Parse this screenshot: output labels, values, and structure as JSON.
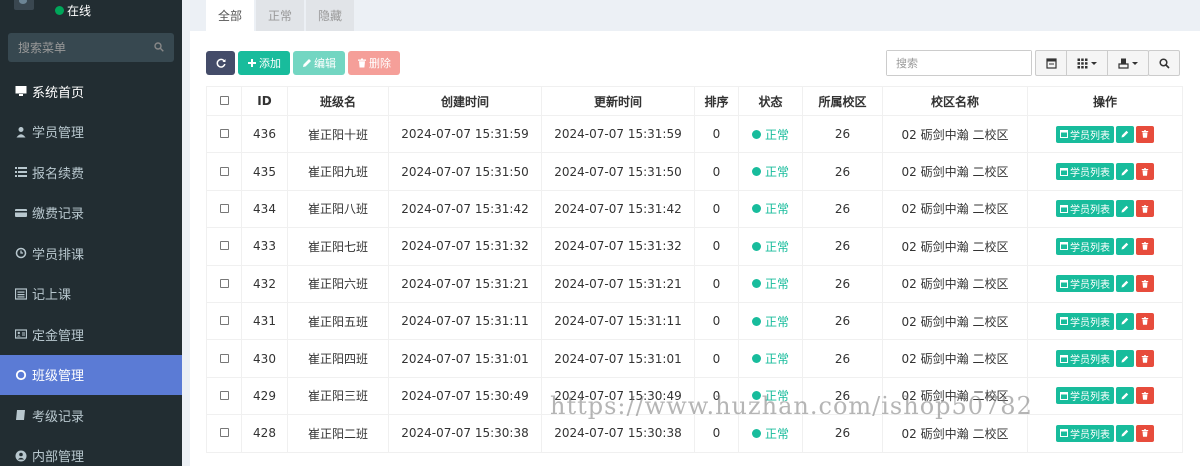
{
  "sidebar": {
    "status": "在线",
    "search_placeholder": "搜索菜单",
    "items": [
      {
        "label": "系统首页",
        "icon": "desktop-icon"
      },
      {
        "label": "学员管理",
        "icon": "user-icon"
      },
      {
        "label": "报名续费",
        "icon": "list-icon"
      },
      {
        "label": "缴费记录",
        "icon": "credit-card-icon"
      },
      {
        "label": "学员排课",
        "icon": "clock-icon"
      },
      {
        "label": "记上课",
        "icon": "list-alt-icon"
      },
      {
        "label": "定金管理",
        "icon": "id-card-icon"
      },
      {
        "label": "班级管理",
        "icon": "circle-icon"
      },
      {
        "label": "考级记录",
        "icon": "book-icon"
      },
      {
        "label": "内部管理",
        "icon": "user-circle-icon"
      }
    ],
    "active_index": 7
  },
  "tabs": [
    "全部",
    "正常",
    "隐藏"
  ],
  "toolbar": {
    "add_label": "添加",
    "edit_label": "编辑",
    "delete_label": "删除",
    "search_placeholder": "搜索"
  },
  "table": {
    "headers": [
      "ID",
      "班级名",
      "创建时间",
      "更新时间",
      "排序",
      "状态",
      "所属校区",
      "校区名称",
      "操作"
    ],
    "op_list_label": "学员列表",
    "rows": [
      {
        "id": "436",
        "name": "崔正阳十班",
        "created": "2024-07-07 15:31:59",
        "updated": "2024-07-07 15:31:59",
        "sort": "0",
        "status": "正常",
        "campus_id": "26",
        "campus_name": "02 砺剑中瀚 二校区"
      },
      {
        "id": "435",
        "name": "崔正阳九班",
        "created": "2024-07-07 15:31:50",
        "updated": "2024-07-07 15:31:50",
        "sort": "0",
        "status": "正常",
        "campus_id": "26",
        "campus_name": "02 砺剑中瀚 二校区"
      },
      {
        "id": "434",
        "name": "崔正阳八班",
        "created": "2024-07-07 15:31:42",
        "updated": "2024-07-07 15:31:42",
        "sort": "0",
        "status": "正常",
        "campus_id": "26",
        "campus_name": "02 砺剑中瀚 二校区"
      },
      {
        "id": "433",
        "name": "崔正阳七班",
        "created": "2024-07-07 15:31:32",
        "updated": "2024-07-07 15:31:32",
        "sort": "0",
        "status": "正常",
        "campus_id": "26",
        "campus_name": "02 砺剑中瀚 二校区"
      },
      {
        "id": "432",
        "name": "崔正阳六班",
        "created": "2024-07-07 15:31:21",
        "updated": "2024-07-07 15:31:21",
        "sort": "0",
        "status": "正常",
        "campus_id": "26",
        "campus_name": "02 砺剑中瀚 二校区"
      },
      {
        "id": "431",
        "name": "崔正阳五班",
        "created": "2024-07-07 15:31:11",
        "updated": "2024-07-07 15:31:11",
        "sort": "0",
        "status": "正常",
        "campus_id": "26",
        "campus_name": "02 砺剑中瀚 二校区"
      },
      {
        "id": "430",
        "name": "崔正阳四班",
        "created": "2024-07-07 15:31:01",
        "updated": "2024-07-07 15:31:01",
        "sort": "0",
        "status": "正常",
        "campus_id": "26",
        "campus_name": "02 砺剑中瀚 二校区"
      },
      {
        "id": "429",
        "name": "崔正阳三班",
        "created": "2024-07-07 15:30:49",
        "updated": "2024-07-07 15:30:49",
        "sort": "0",
        "status": "正常",
        "campus_id": "26",
        "campus_name": "02 砺剑中瀚 二校区"
      },
      {
        "id": "428",
        "name": "崔正阳二班",
        "created": "2024-07-07 15:30:38",
        "updated": "2024-07-07 15:30:38",
        "sort": "0",
        "status": "正常",
        "campus_id": "26",
        "campus_name": "02 砺剑中瀚 二校区"
      }
    ]
  },
  "watermark": "https://www.huzhan.com/ishop50782",
  "colors": {
    "sidebar_bg": "#222d32",
    "sidebar_active": "#5b7bd5",
    "success": "#18bc9c",
    "danger": "#e74c3c",
    "primary_dark": "#444c69"
  }
}
